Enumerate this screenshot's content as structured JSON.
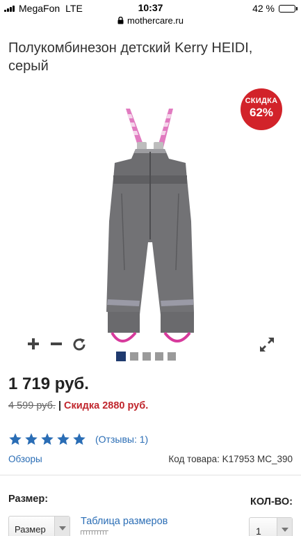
{
  "status_bar": {
    "carrier": "MegaFon",
    "network": "LTE",
    "time": "10:37",
    "battery": "42 %",
    "battery_level": 0.42
  },
  "browser": {
    "url": "mothercare.ru"
  },
  "product": {
    "title": "Полукомбинезон детский Kerry HEIDI, серый",
    "badge_label": "СКИДКА",
    "badge_value": "62%",
    "image_icon": "overalls-photo",
    "price": "1 719 руб.",
    "old_price": "4 599 руб.",
    "separator": "|",
    "discount_text": "Скидка 2880 руб.",
    "rating_stars": 5,
    "reviews_link": "(Отзывы: 1)",
    "reviews_nav": "Обзоры",
    "sku": "Код товара: K17953 MC_390"
  },
  "gallery": {
    "zoom_in_icon": "plus-icon",
    "zoom_out_icon": "minus-icon",
    "rotate_icon": "rotate-icon",
    "expand_icon": "expand-icon",
    "slides": 5,
    "active_slide": 1
  },
  "purchase": {
    "size_label": "Размер:",
    "size_value": "Размер",
    "size_table_link": "Таблица размеров",
    "qty_label": "КОЛ-ВО:",
    "qty_value": "1"
  },
  "colors": {
    "accent_blue": "#2a6db5",
    "badge_red": "#d2232a",
    "discount_red": "#c0262d",
    "active_dot": "#1f3a6e"
  }
}
